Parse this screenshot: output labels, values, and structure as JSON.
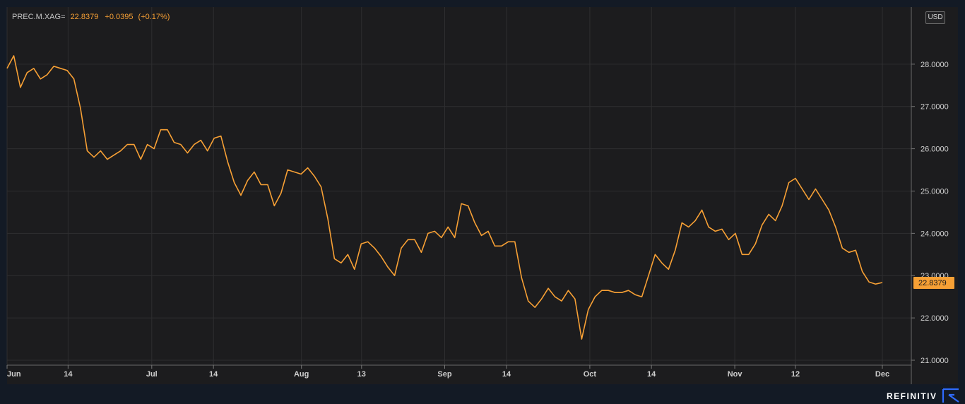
{
  "legend": {
    "symbol": "PREC.M.XAG=",
    "last": "22.8379",
    "change": "+0.0395",
    "change_pct": "(+0.17%)"
  },
  "currency": "USD",
  "brand": "REFINITIV",
  "colors": {
    "line": "#f7a035",
    "background": "#1c1c1e",
    "grid": "#2e2e30",
    "axis_text": "#d0d0d0",
    "price_tag": "#f7a035"
  },
  "chart_data": {
    "type": "line",
    "series": [
      {
        "name": "PREC.M.XAG=",
        "values": [
          27.9,
          28.2,
          27.45,
          27.8,
          27.9,
          27.65,
          27.75,
          27.95,
          27.9,
          27.85,
          27.65,
          26.95,
          25.95,
          25.8,
          25.95,
          25.75,
          25.85,
          25.95,
          26.1,
          26.1,
          25.75,
          26.1,
          26.0,
          26.45,
          26.45,
          26.15,
          26.1,
          25.9,
          26.1,
          26.2,
          25.95,
          26.25,
          26.3,
          25.7,
          25.2,
          24.9,
          25.25,
          25.45,
          25.15,
          25.15,
          24.65,
          24.95,
          25.5,
          25.45,
          25.4,
          25.55,
          25.35,
          25.1,
          24.35,
          23.4,
          23.3,
          23.5,
          23.15,
          23.75,
          23.8,
          23.65,
          23.45,
          23.2,
          23.0,
          23.65,
          23.85,
          23.85,
          23.55,
          24.0,
          24.05,
          23.9,
          24.15,
          23.9,
          24.7,
          24.65,
          24.25,
          23.95,
          24.05,
          23.7,
          23.7,
          23.8,
          23.8,
          22.95,
          22.4,
          22.25,
          22.45,
          22.7,
          22.5,
          22.4,
          22.65,
          22.45,
          21.5,
          22.2,
          22.5,
          22.65,
          22.65,
          22.6,
          22.6,
          22.65,
          22.55,
          22.5,
          23.0,
          23.5,
          23.3,
          23.15,
          23.6,
          24.25,
          24.15,
          24.3,
          24.55,
          24.15,
          24.05,
          24.1,
          23.85,
          24.0,
          23.5,
          23.5,
          23.75,
          24.2,
          24.45,
          24.3,
          24.65,
          25.2,
          25.3,
          25.05,
          24.8,
          25.05,
          24.8,
          24.55,
          24.15,
          23.65,
          23.55,
          23.6,
          23.1,
          22.85,
          22.8,
          22.8379
        ]
      }
    ],
    "x_range": [
      "Jun 1",
      "Dec 1"
    ],
    "x_ticks": [
      {
        "label": "Jun",
        "frac": 0.0
      },
      {
        "label": "14",
        "frac": 0.0697
      },
      {
        "label": "Jul",
        "frac": 0.1653
      },
      {
        "label": "14",
        "frac": 0.2358
      },
      {
        "label": "Aug",
        "frac": 0.3363
      },
      {
        "label": "13",
        "frac": 0.405
      },
      {
        "label": "Sep",
        "frac": 0.5
      },
      {
        "label": "14",
        "frac": 0.5706
      },
      {
        "label": "Oct",
        "frac": 0.6658
      },
      {
        "label": "14",
        "frac": 0.7362
      },
      {
        "label": "Nov",
        "frac": 0.8314
      },
      {
        "label": "12",
        "frac": 0.9007
      },
      {
        "label": "Dec",
        "frac": 1.0
      }
    ],
    "y_ticks": [
      "28.0000",
      "27.0000",
      "26.0000",
      "25.0000",
      "24.0000",
      "23.0000",
      "22.0000",
      "21.0000"
    ],
    "ylim": [
      20.9,
      29.35
    ],
    "last_value_label": "22.8379",
    "grid": true,
    "y_axis_side": "right"
  }
}
